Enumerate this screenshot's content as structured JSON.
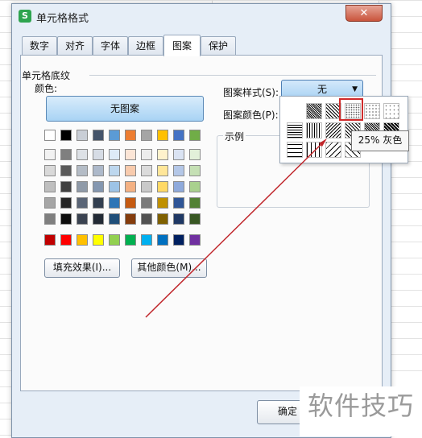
{
  "window": {
    "title": "单元格格式",
    "app_icon": "S",
    "close_symbol": "✕"
  },
  "tabs": [
    {
      "label": "数字"
    },
    {
      "label": "对齐"
    },
    {
      "label": "字体"
    },
    {
      "label": "边框"
    },
    {
      "label": "图案",
      "active": true
    },
    {
      "label": "保护"
    }
  ],
  "shading": {
    "section_title": "单元格底纹",
    "color_label": "颜色:",
    "no_pattern_button": "无图案",
    "fill_effects_button": "填充效果(I)...",
    "more_colors_button": "其他颜色(M)..."
  },
  "palette_rows": [
    [
      "#ffffff",
      "#000000",
      "#c9ced6",
      "#44546a",
      "#5b9bd5",
      "#ed7d31",
      "#a5a5a5",
      "#ffc000",
      "#4472c4",
      "#70ad47"
    ],
    [
      "#f2f2f2",
      "#7f7f7f",
      "#dde1e6",
      "#d6dce5",
      "#deebf7",
      "#fbe5d6",
      "#ededed",
      "#fff2cc",
      "#dae3f3",
      "#e2f0d9"
    ],
    [
      "#d9d9d9",
      "#595959",
      "#b4bcc6",
      "#adb9ca",
      "#bdd7ee",
      "#f8cbad",
      "#dbdbdb",
      "#ffe699",
      "#b4c7e7",
      "#c5e0b4"
    ],
    [
      "#bfbfbf",
      "#404040",
      "#8f9aa8",
      "#8497b0",
      "#9dc3e6",
      "#f4b183",
      "#c9c9c9",
      "#ffd966",
      "#8faadc",
      "#a9d18e"
    ],
    [
      "#a6a6a6",
      "#262626",
      "#5a6576",
      "#333f50",
      "#2e75b6",
      "#c55a11",
      "#7b7b7b",
      "#bf9000",
      "#2f5597",
      "#538135"
    ],
    [
      "#7f7f7f",
      "#0d0d0d",
      "#3a4250",
      "#222a35",
      "#1f4e79",
      "#843c0c",
      "#525252",
      "#7f6000",
      "#1f3864",
      "#385723"
    ],
    [
      "#c00000",
      "#ff0000",
      "#ffc000",
      "#ffff00",
      "#92d050",
      "#00b050",
      "#00b0f0",
      "#0070c0",
      "#002060",
      "#7030a0"
    ]
  ],
  "pattern": {
    "style_label": "图案样式(S):",
    "style_value": "无",
    "color_label": "图案颜色(P):",
    "sample_label": "示例",
    "tooltip": "25% 灰色",
    "caret": "▼"
  },
  "footer": {
    "ok_button": "确定"
  },
  "watermark": "软件技巧"
}
